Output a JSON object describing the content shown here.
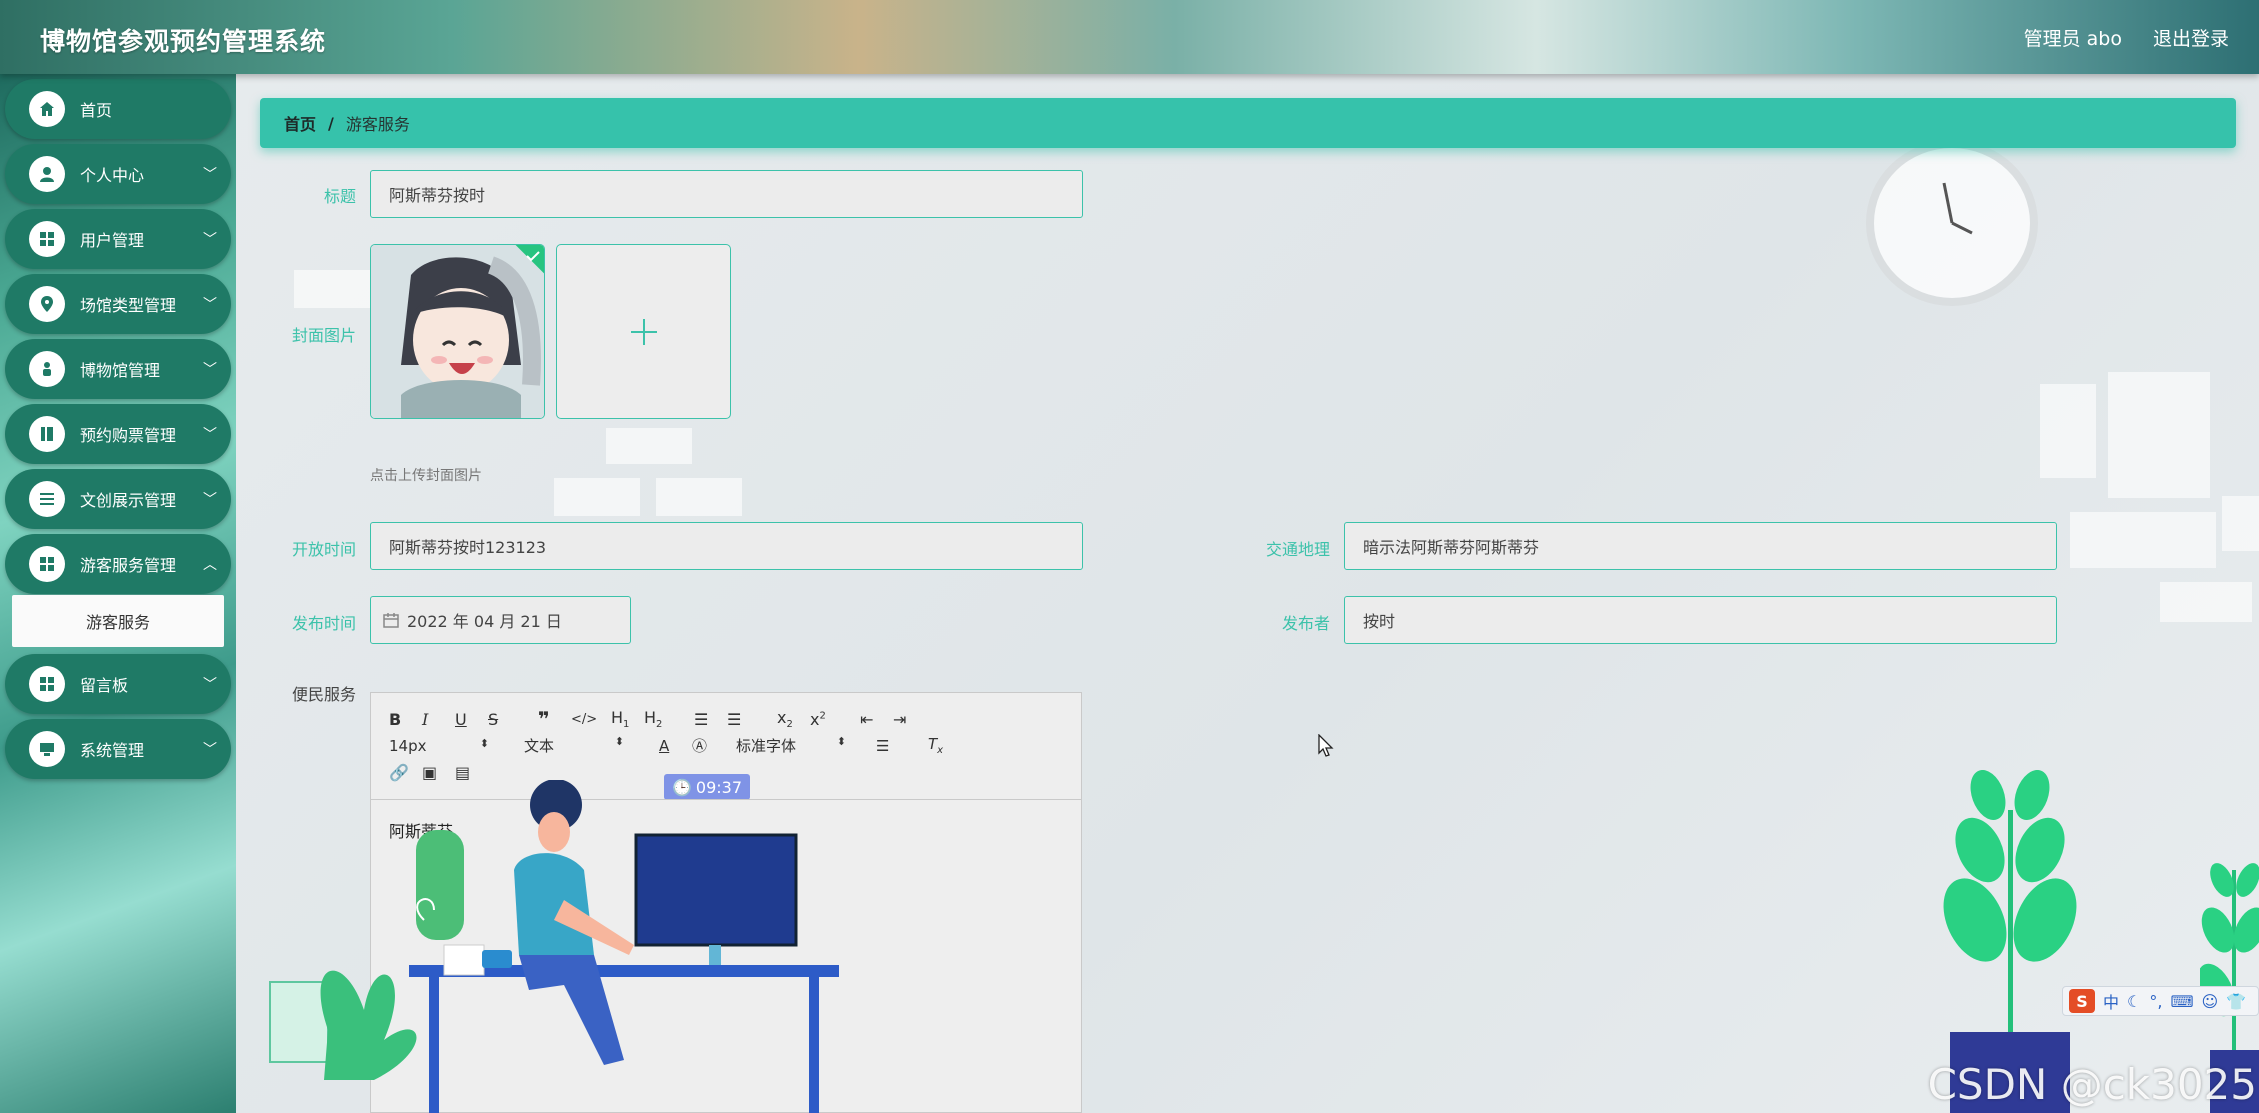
{
  "header": {
    "title": "博物馆参观预约管理系统",
    "user": "管理员 abo",
    "logout": "退出登录"
  },
  "sidebar": {
    "items": [
      {
        "label": "首页",
        "icon": "home-icon",
        "arrow": false
      },
      {
        "label": "个人中心",
        "icon": "user-icon",
        "arrow": true
      },
      {
        "label": "用户管理",
        "icon": "grid-icon",
        "arrow": true
      },
      {
        "label": "场馆类型管理",
        "icon": "location-icon",
        "arrow": true
      },
      {
        "label": "博物馆管理",
        "icon": "person-icon",
        "arrow": true
      },
      {
        "label": "预约购票管理",
        "icon": "book-icon",
        "arrow": true
      },
      {
        "label": "文创展示管理",
        "icon": "list-icon",
        "arrow": true
      },
      {
        "label": "游客服务管理",
        "icon": "grid-icon",
        "arrow": true
      },
      {
        "label": "留言板",
        "icon": "grid-icon",
        "arrow": true
      },
      {
        "label": "系统管理",
        "icon": "monitor-icon",
        "arrow": true
      }
    ],
    "sub_item": "游客服务"
  },
  "breadcrumb": {
    "home": "首页",
    "separator": "/",
    "current": "游客服务"
  },
  "form": {
    "title_label": "标题",
    "title_value": "阿斯蒂芬按时",
    "cover_label": "封面图片",
    "cover_hint": "点击上传封面图片",
    "open_time_label": "开放时间",
    "open_time_value": "阿斯蒂芬按时123123",
    "traffic_label": "交通地理",
    "traffic_value": "暗示法阿斯蒂芬阿斯蒂芬",
    "publish_time_label": "发布时间",
    "publish_time_value": "2022 年 04 月 21 日",
    "publisher_label": "发布者",
    "publisher_value": "按时",
    "service_label": "便民服务"
  },
  "editor": {
    "font_size": "14px",
    "paragraph": "文本",
    "font_family": "标准字体",
    "time_badge": "09:37",
    "content": "阿斯蒂芬"
  },
  "watermark": "CSDN @ck3025",
  "ime": {
    "label": "中"
  },
  "colors": {
    "accent": "#36c2ab",
    "nav": "#1f7a66",
    "label": "#3cc2aa"
  }
}
